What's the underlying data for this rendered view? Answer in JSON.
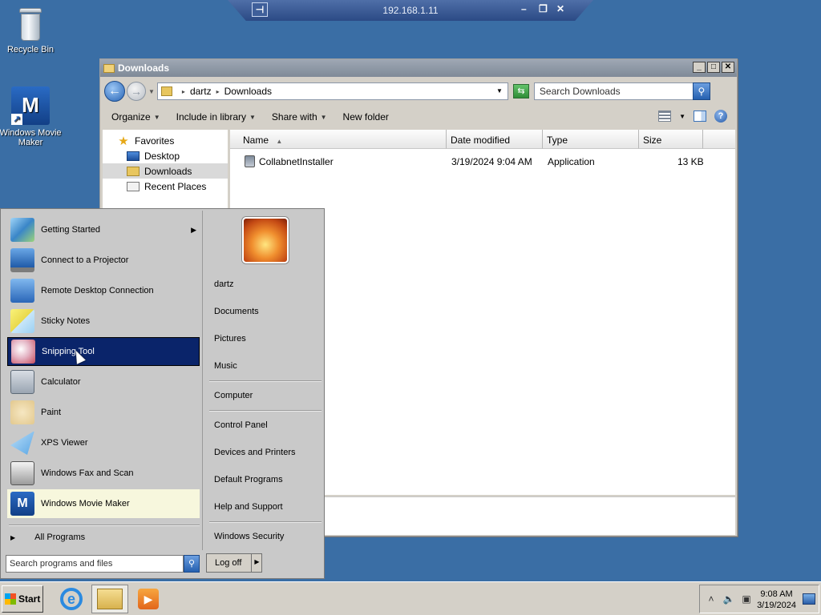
{
  "rdp": {
    "title": "192.168.1.11",
    "pin": "⊣",
    "minimize": "–",
    "restore": "❐",
    "close": "✕"
  },
  "desktop": {
    "icons": [
      {
        "label": "Recycle Bin"
      },
      {
        "label": "Windows Movie Maker"
      }
    ]
  },
  "explorer": {
    "title": "Downloads",
    "controls": {
      "minimize": "_",
      "maximize": "□",
      "close": "✕"
    },
    "address": {
      "parts": [
        "dartz",
        "Downloads"
      ],
      "sep": "▸"
    },
    "search": {
      "placeholder": "Search Downloads"
    },
    "commands": [
      "Organize",
      "Include in library",
      "Share with",
      "New folder"
    ],
    "nav": {
      "favorites": "Favorites",
      "items": [
        "Desktop",
        "Downloads",
        "Recent Places"
      ]
    },
    "columns": [
      "Name",
      "Date modified",
      "Type",
      "Size"
    ],
    "files": [
      {
        "name": "CollabnetInstaller",
        "date": "3/19/2024 9:04 AM",
        "type": "Application",
        "size": "13 KB"
      }
    ]
  },
  "start_menu": {
    "programs": [
      {
        "label": "Getting Started"
      },
      {
        "label": "Connect to a Projector"
      },
      {
        "label": "Remote Desktop Connection"
      },
      {
        "label": "Sticky Notes"
      },
      {
        "label": "Snipping Tool"
      },
      {
        "label": "Calculator"
      },
      {
        "label": "Paint"
      },
      {
        "label": "XPS Viewer"
      },
      {
        "label": "Windows Fax and Scan"
      },
      {
        "label": "Windows Movie Maker"
      }
    ],
    "all_programs": "All Programs",
    "search": {
      "placeholder": "Search programs and files"
    },
    "right_links": [
      "dartz",
      "Documents",
      "Pictures",
      "Music",
      "Computer",
      "Control Panel",
      "Devices and Printers",
      "Default Programs",
      "Help and Support",
      "Windows Security"
    ],
    "log_off": "Log off"
  },
  "taskbar": {
    "start": "Start",
    "clock": {
      "time": "9:08 AM",
      "date": "3/19/2024"
    }
  },
  "colors": {
    "desktop": "#3a6ea5",
    "highlight": "#0a246a",
    "pinned": "#f7f7dd"
  }
}
